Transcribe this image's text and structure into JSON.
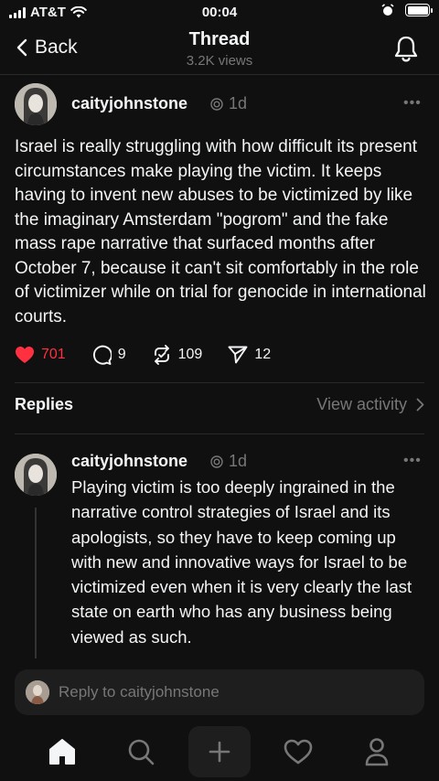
{
  "status_bar": {
    "carrier": "AT&T",
    "time": "00:04"
  },
  "header": {
    "back_label": "Back",
    "title": "Thread",
    "views": "3.2K views"
  },
  "post": {
    "username": "caityjohnstone",
    "age": "1d",
    "more": "•••",
    "text": "Israel is really struggling with how difficult its present circumstances make playing the victim. It keeps having to invent new abuses to be victimized by like the imaginary Amsterdam \"pogrom\" and the fake mass rape narrative that surfaced months after October 7, because it can't sit comfortably in the role of victimizer while on trial for genocide in international courts.",
    "likes": "701",
    "comments": "9",
    "reposts": "109",
    "shares": "12"
  },
  "replies_section": {
    "label": "Replies",
    "view_activity": "View activity"
  },
  "reply": {
    "username": "caityjohnstone",
    "age": "1d",
    "more": "•••",
    "text": "Playing victim is too deeply ingrained in the narrative control strategies of Israel and its apologists, so they have to keep coming up with new and innovative ways for Israel to be victimized even when it is very clearly the last state on earth who has any business being viewed as such."
  },
  "composer": {
    "placeholder": "Reply to caityjohnstone"
  },
  "colors": {
    "like": "#ff3040",
    "background": "#101010",
    "muted": "#777777"
  },
  "icons": [
    "back-chevron-icon",
    "bell-icon",
    "heart-icon",
    "comment-icon",
    "repost-icon",
    "share-icon",
    "chevron-right-icon",
    "home-icon",
    "search-icon",
    "plus-icon",
    "activity-heart-icon",
    "profile-icon"
  ]
}
